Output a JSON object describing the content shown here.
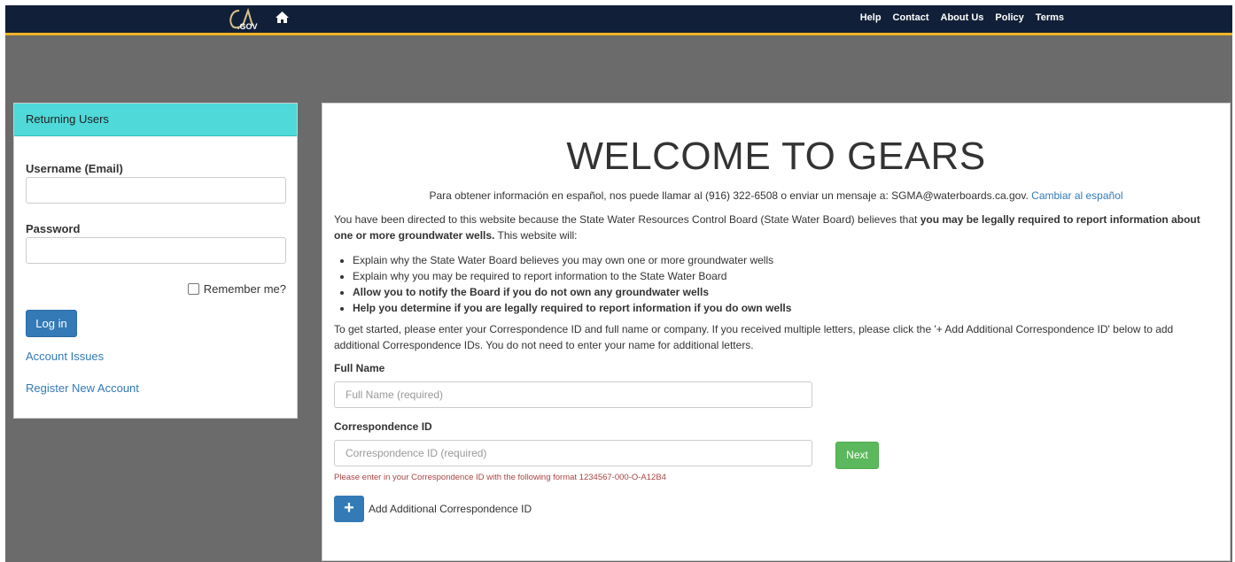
{
  "header": {
    "logo_text": "CA.GOV",
    "home_icon": "home-icon",
    "nav": [
      "Help",
      "Contact",
      "About Us",
      "Policy",
      "Terms"
    ]
  },
  "sidebar": {
    "title": "Returning Users",
    "username_label": "Username (Email)",
    "username_value": "",
    "password_label": "Password",
    "password_value": "",
    "remember_label": "Remember me?",
    "login_label": "Log in",
    "account_issues": "Account Issues",
    "register": "Register New Account"
  },
  "main": {
    "title": "WELCOME TO GEARS",
    "spanish_text": "Para obtener información en español, nos puede llamar al (916) 322-6508 o enviar un mensaje a: SGMA@waterboards.ca.gov.",
    "spanish_link": "Cambiar al español",
    "intro_plain": "You have been directed to this website because the State Water Resources Control Board (State Water Board) believes that ",
    "intro_bold": "you may be legally required to report information about one or more groundwater wells.",
    "intro_tail": " This website will:",
    "bullets": [
      "Explain why the State Water Board believes you may own one or more groundwater wells",
      "Explain why you may be required to report information to the State Water Board",
      "Allow you to notify the Board if you do not own any groundwater wells",
      "Help you determine if you are legally required to report information if you do own wells"
    ],
    "instructions": "To get started, please enter your Correspondence ID and full name or company. If you received multiple letters, please click the '+ Add Additional Correspondence ID' below to add additional Correspondence IDs. You do not need to enter your name for additional letters.",
    "full_name_label": "Full Name",
    "full_name_placeholder": "Full Name (required)",
    "corr_label": "Correspondence ID",
    "corr_placeholder": "Correspondence ID (required)",
    "next_label": "Next",
    "hint": "Please enter in your Correspondence ID with the following format 1234567-000-O-A12B4",
    "add_icon": "+",
    "add_label": "Add Additional Correspondence ID"
  },
  "colors": {
    "topbar": "#112038",
    "topbar_accent": "#f0b323",
    "sidebar_header": "#4fd9d9",
    "primary": "#337ab7",
    "success": "#5cb85c",
    "error": "#a94442"
  }
}
